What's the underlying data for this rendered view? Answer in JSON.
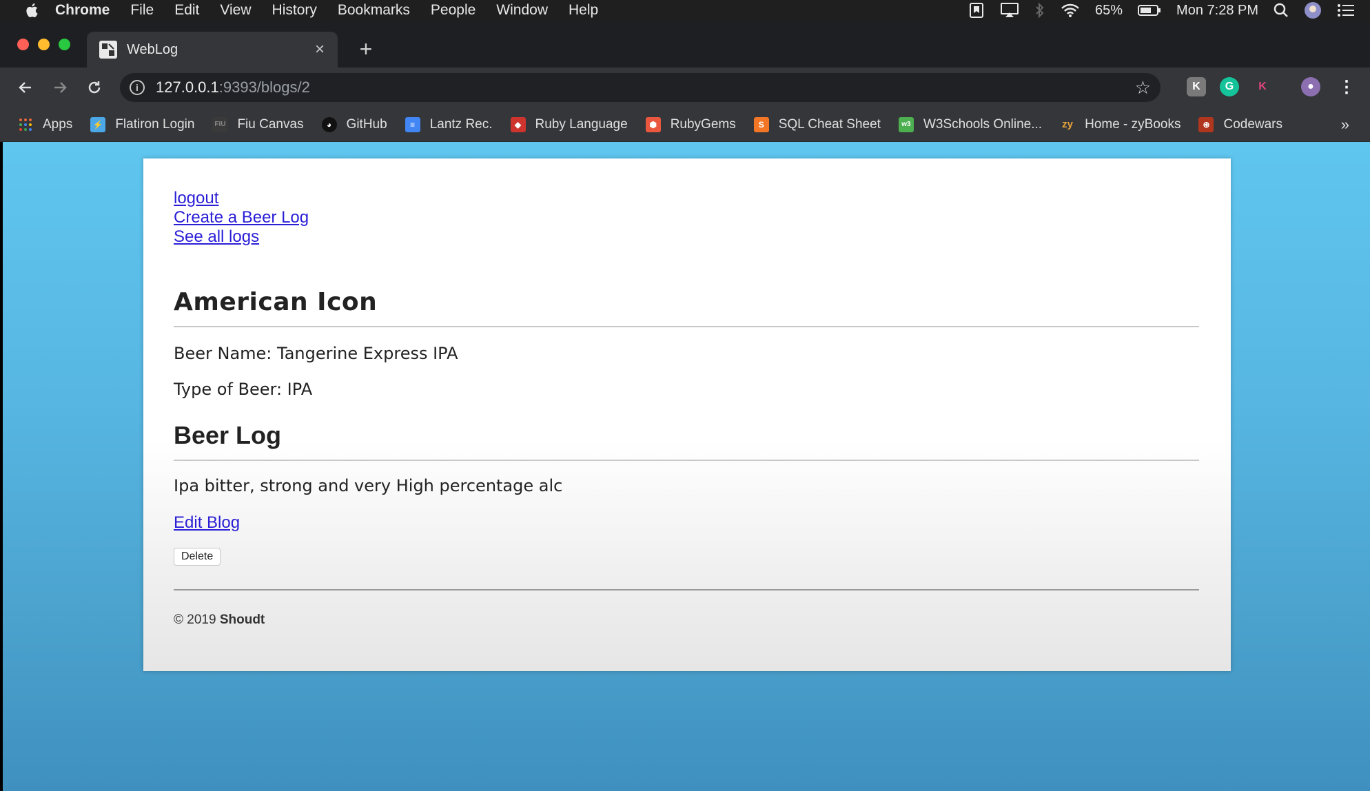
{
  "menubar": {
    "app": "Chrome",
    "items": [
      "File",
      "Edit",
      "View",
      "History",
      "Bookmarks",
      "People",
      "Window",
      "Help"
    ],
    "battery": "65%",
    "clock": "Mon 7:28 PM"
  },
  "tab": {
    "title": "WebLog",
    "close": "×",
    "new": "+"
  },
  "toolbar": {
    "url_host": "127.0.0.1",
    "url_path": ":9393/blogs/2"
  },
  "bookmarks": [
    {
      "label": "Apps",
      "icon": "apps-grid-icon",
      "color": "#e8693b"
    },
    {
      "label": "Flatiron Login",
      "icon": "flatiron-icon",
      "color": "#4ba7e6"
    },
    {
      "label": "Fiu Canvas",
      "icon": "fiu-icon",
      "color": "#3a3a3a"
    },
    {
      "label": "GitHub",
      "icon": "github-icon",
      "color": "#222222"
    },
    {
      "label": "Lantz Rec.",
      "icon": "doc-icon",
      "color": "#4285f4"
    },
    {
      "label": "Ruby Language",
      "icon": "ruby-icon",
      "color": "#cc342d"
    },
    {
      "label": "RubyGems",
      "icon": "rubygems-icon",
      "color": "#e9573f"
    },
    {
      "label": "SQL Cheat Sheet",
      "icon": "sql-icon",
      "color": "#f37626"
    },
    {
      "label": "W3Schools Online...",
      "icon": "w3-icon",
      "color": "#4caf50"
    },
    {
      "label": "Home - zyBooks",
      "icon": "zybooks-icon",
      "color": "#e8a33b"
    },
    {
      "label": "Codewars",
      "icon": "codewars-icon",
      "color": "#b1361e"
    }
  ],
  "bookmarks_more": "»",
  "page": {
    "links": [
      "logout",
      "Create a Beer Log",
      "See all logs"
    ],
    "brewery": "American Icon",
    "beer_name": "Beer Name: Tangerine Express IPA",
    "beer_type": "Type of Beer: IPA",
    "log_heading": "Beer Log",
    "log_text": "Ipa bitter, strong and very High percentage alc",
    "edit_link": "Edit Blog",
    "delete_button": "Delete",
    "footer_prefix": "© 2019 ",
    "footer_name": "Shoudt"
  }
}
